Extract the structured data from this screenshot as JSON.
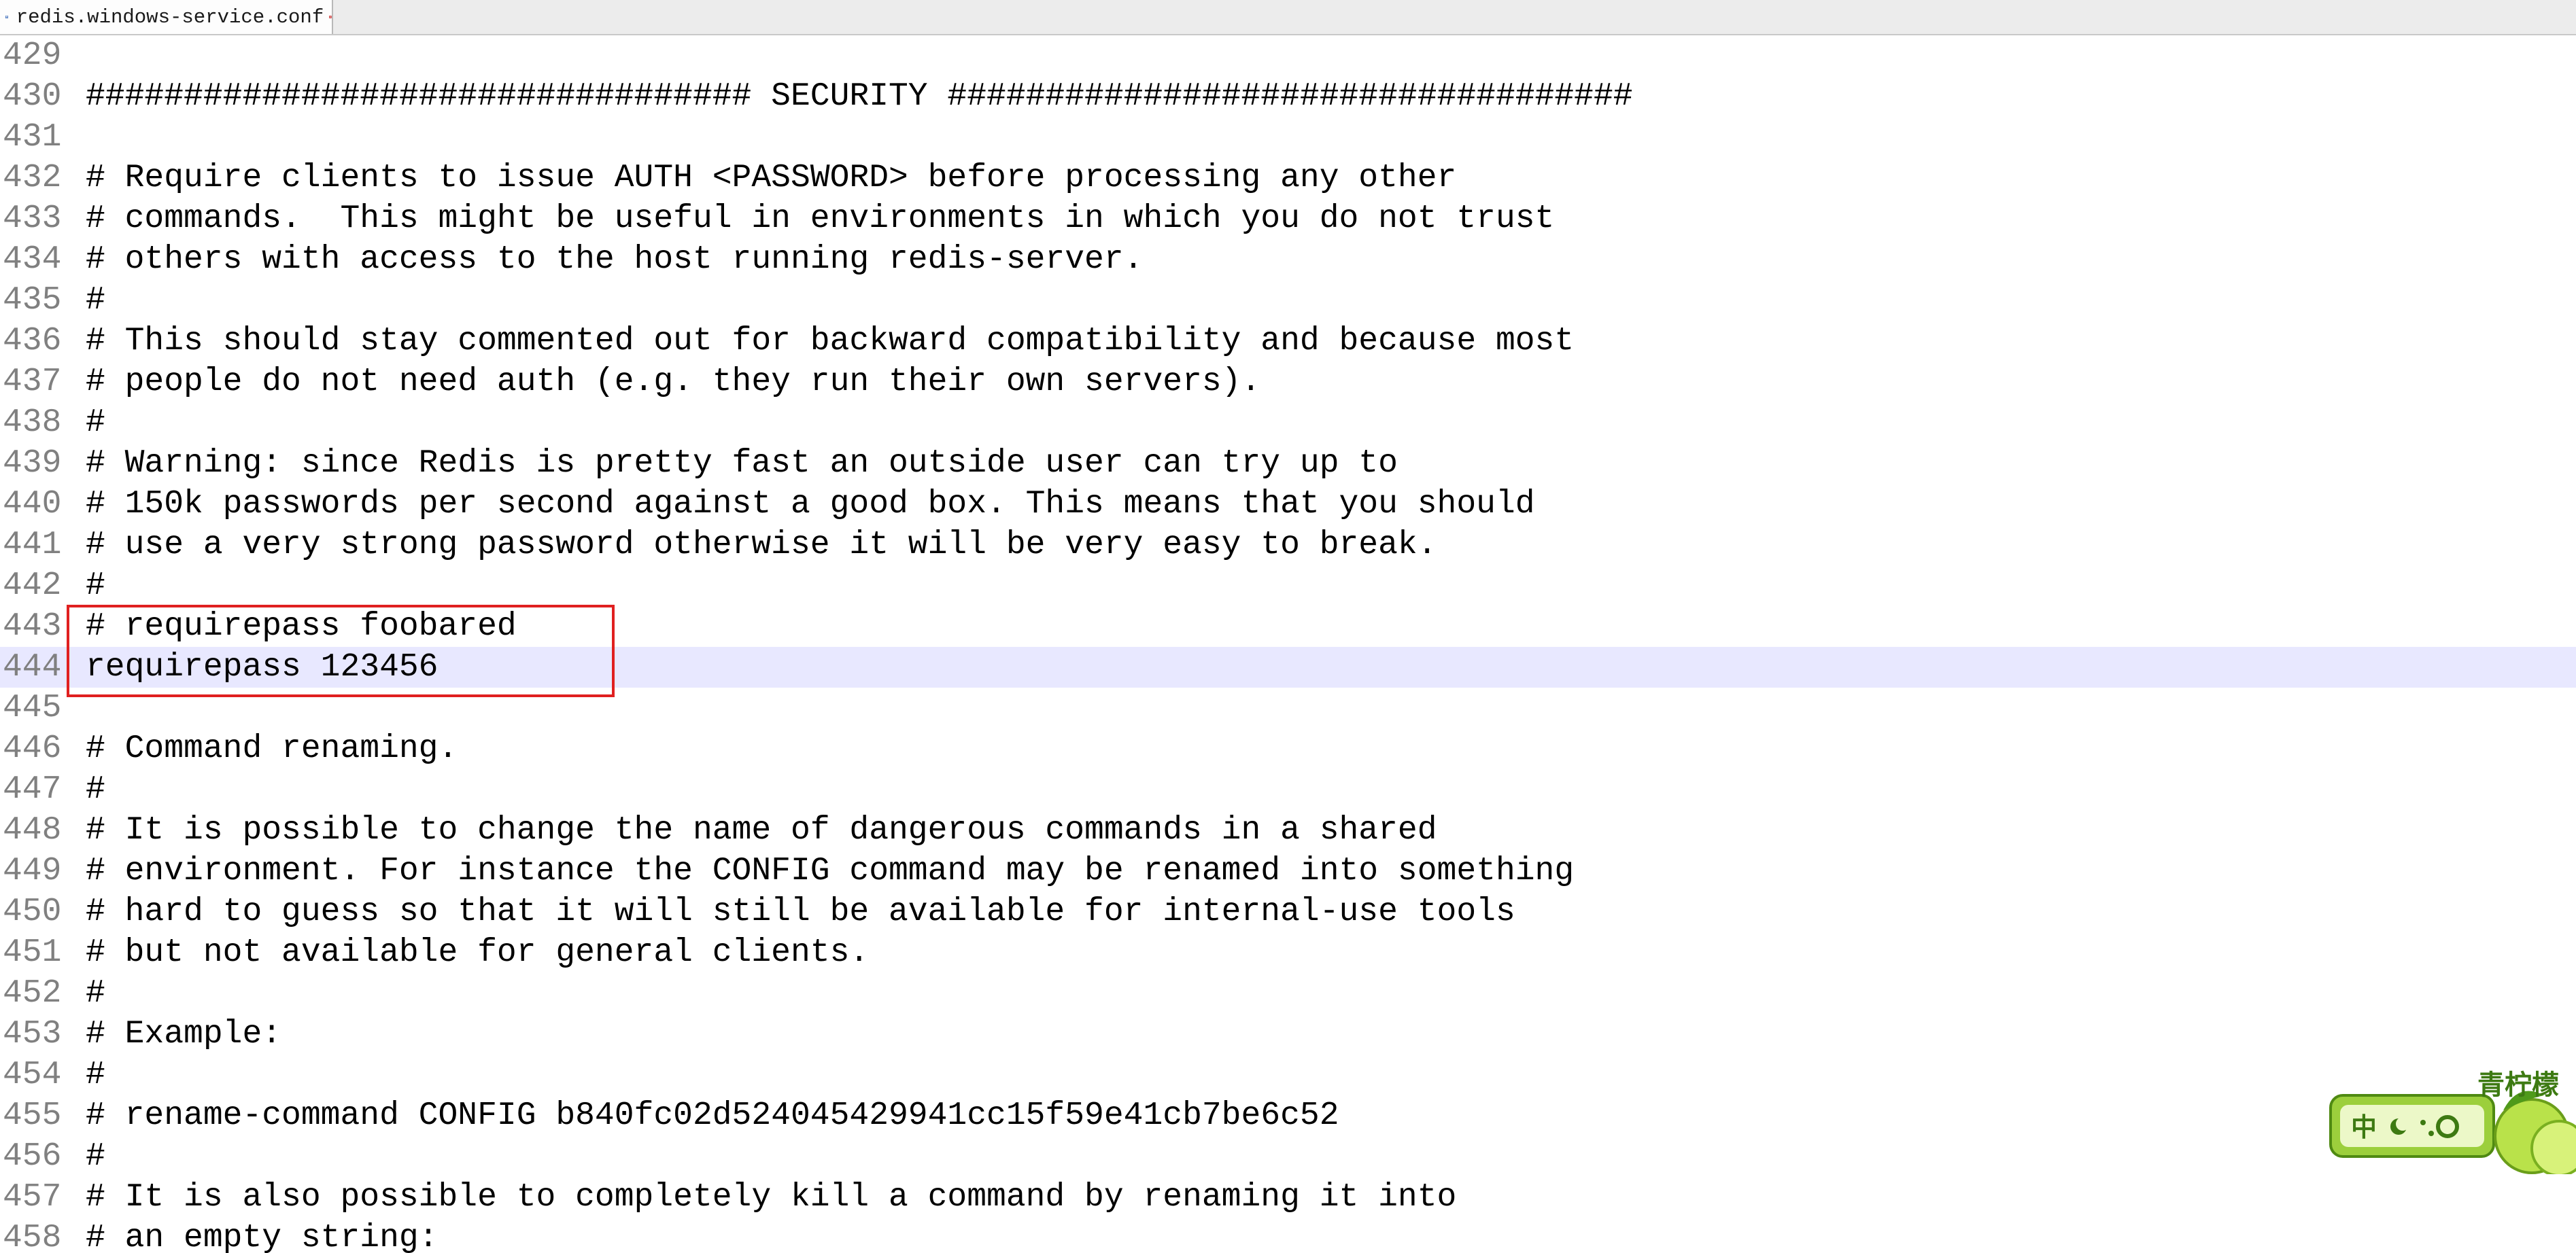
{
  "tab": {
    "title": "redis.windows-service.conf",
    "icon": "save-file-icon",
    "close_icon": "close-icon"
  },
  "editor": {
    "current_line": "444",
    "lines": [
      {
        "num": "429",
        "text": ""
      },
      {
        "num": "430",
        "text": "################################## SECURITY ###################################"
      },
      {
        "num": "431",
        "text": ""
      },
      {
        "num": "432",
        "text": "# Require clients to issue AUTH <PASSWORD> before processing any other"
      },
      {
        "num": "433",
        "text": "# commands.  This might be useful in environments in which you do not trust"
      },
      {
        "num": "434",
        "text": "# others with access to the host running redis-server."
      },
      {
        "num": "435",
        "text": "#"
      },
      {
        "num": "436",
        "text": "# This should stay commented out for backward compatibility and because most"
      },
      {
        "num": "437",
        "text": "# people do not need auth (e.g. they run their own servers)."
      },
      {
        "num": "438",
        "text": "#"
      },
      {
        "num": "439",
        "text": "# Warning: since Redis is pretty fast an outside user can try up to"
      },
      {
        "num": "440",
        "text": "# 150k passwords per second against a good box. This means that you should"
      },
      {
        "num": "441",
        "text": "# use a very strong password otherwise it will be very easy to break."
      },
      {
        "num": "442",
        "text": "#"
      },
      {
        "num": "443",
        "text": "# requirepass foobared"
      },
      {
        "num": "444",
        "text": "requirepass 123456"
      },
      {
        "num": "445",
        "text": ""
      },
      {
        "num": "446",
        "text": "# Command renaming."
      },
      {
        "num": "447",
        "text": "#"
      },
      {
        "num": "448",
        "text": "# It is possible to change the name of dangerous commands in a shared"
      },
      {
        "num": "449",
        "text": "# environment. For instance the CONFIG command may be renamed into something"
      },
      {
        "num": "450",
        "text": "# hard to guess so that it will still be available for internal-use tools"
      },
      {
        "num": "451",
        "text": "# but not available for general clients."
      },
      {
        "num": "452",
        "text": "#"
      },
      {
        "num": "453",
        "text": "# Example:"
      },
      {
        "num": "454",
        "text": "#"
      },
      {
        "num": "455",
        "text": "# rename-command CONFIG b840fc02d524045429941cc15f59e41cb7be6c52"
      },
      {
        "num": "456",
        "text": "#"
      },
      {
        "num": "457",
        "text": "# It is also possible to completely kill a command by renaming it into"
      },
      {
        "num": "458",
        "text": "# an empty string:"
      }
    ]
  },
  "annotation": {
    "color": "#e02020"
  },
  "ime_widget": {
    "brand": "青柠檬",
    "mode_label": "中",
    "icon": "lemon-ime-icon"
  }
}
